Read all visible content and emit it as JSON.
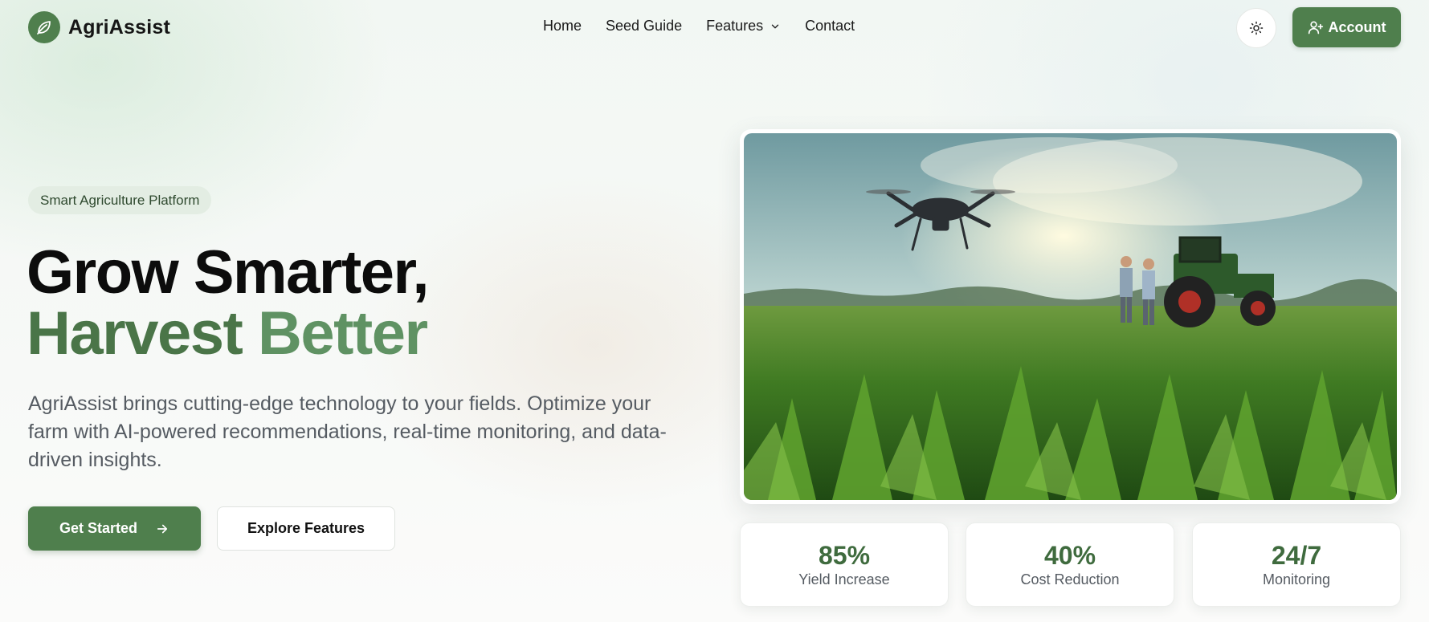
{
  "brand": {
    "name": "AgriAssist",
    "icon": "leaf-icon"
  },
  "nav": {
    "items": [
      {
        "label": "Home"
      },
      {
        "label": "Seed Guide"
      },
      {
        "label": "Features",
        "has_dropdown": true
      },
      {
        "label": "Contact"
      }
    ],
    "theme_toggle_icon": "sun-icon",
    "account": {
      "label": "Account",
      "icon": "user-plus-icon"
    }
  },
  "hero": {
    "badge": "Smart Agriculture Platform",
    "headline": {
      "line1": "Grow Smarter,",
      "line2a": "Harvest",
      "line2b": "Better"
    },
    "description": "AgriAssist brings cutting-edge technology to your fields. Optimize your farm with AI-powered recommendations, real-time monitoring, and data-driven insights.",
    "primary_cta": "Get Started",
    "secondary_cta": "Explore Features",
    "image": "field-with-drone-and-tractor"
  },
  "stats": [
    {
      "value": "85%",
      "label": "Yield Increase"
    },
    {
      "value": "40%",
      "label": "Cost Reduction"
    },
    {
      "value": "24/7",
      "label": "Monitoring"
    }
  ],
  "colors": {
    "brand_green": "#4f7f4d",
    "headline_green": "#4a7548",
    "headline_green_light": "#5f9263",
    "stat_green": "#3f6b3e"
  }
}
